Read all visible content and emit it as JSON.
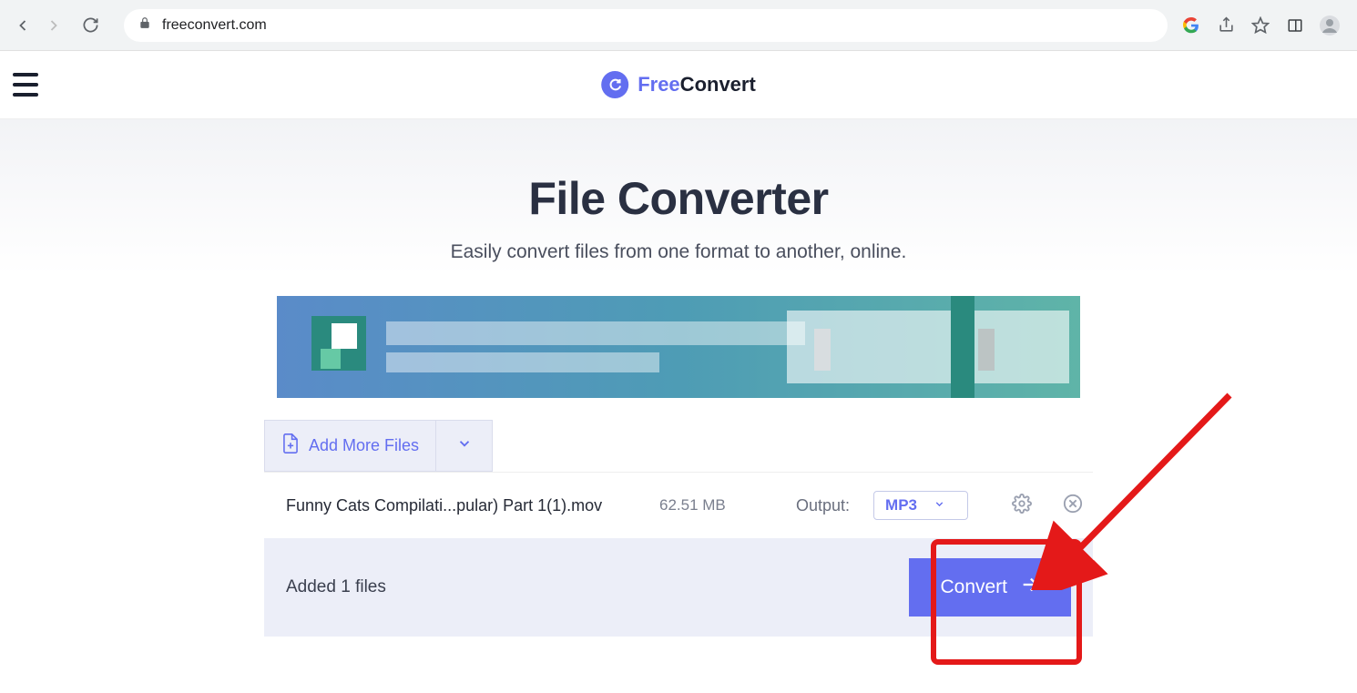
{
  "browser": {
    "url": "freeconvert.com"
  },
  "logo": {
    "prefix": "Free",
    "suffix": "Convert"
  },
  "page": {
    "title": "File Converter",
    "subtitle": "Easily convert files from one format to another, online."
  },
  "tool": {
    "addMoreLabel": "Add More Files",
    "outputLabel": "Output:",
    "convertLabel": "Convert",
    "footerText": "Added 1 files"
  },
  "file": {
    "name": "Funny Cats Compilati...pular) Part 1(1).mov",
    "size": "62.51 MB",
    "format": "MP3"
  }
}
